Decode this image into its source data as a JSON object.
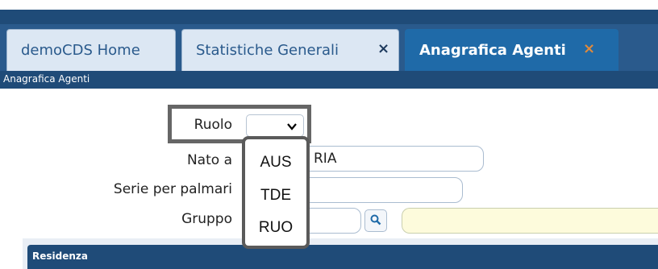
{
  "tabs": [
    {
      "label": "demoCDS Home",
      "closable": false,
      "active": false
    },
    {
      "label": "Statistiche Generali",
      "closable": true,
      "active": false
    },
    {
      "label": "Anagrafica Agenti",
      "closable": true,
      "active": true
    }
  ],
  "close_glyph": "×",
  "page_header": "Anagrafica Agenti",
  "form": {
    "ruolo_label": "Ruolo",
    "ruolo_value": "",
    "nato_a_label": "Nato a",
    "nato_a_value": "RIA",
    "serie_label": "Serie per palmari",
    "serie_value": "",
    "gruppo_label": "Gruppo",
    "gruppo_value": "",
    "gruppo_desc_value": ""
  },
  "dropdown": {
    "options": [
      "AUS",
      "TDE",
      "RUO"
    ]
  },
  "section": {
    "title": "Residenza"
  },
  "colors": {
    "tabbar": "#2a5a8c",
    "active_tab": "#1f6aa8",
    "header": "#1f4b78",
    "close_active": "#e08a3c"
  }
}
